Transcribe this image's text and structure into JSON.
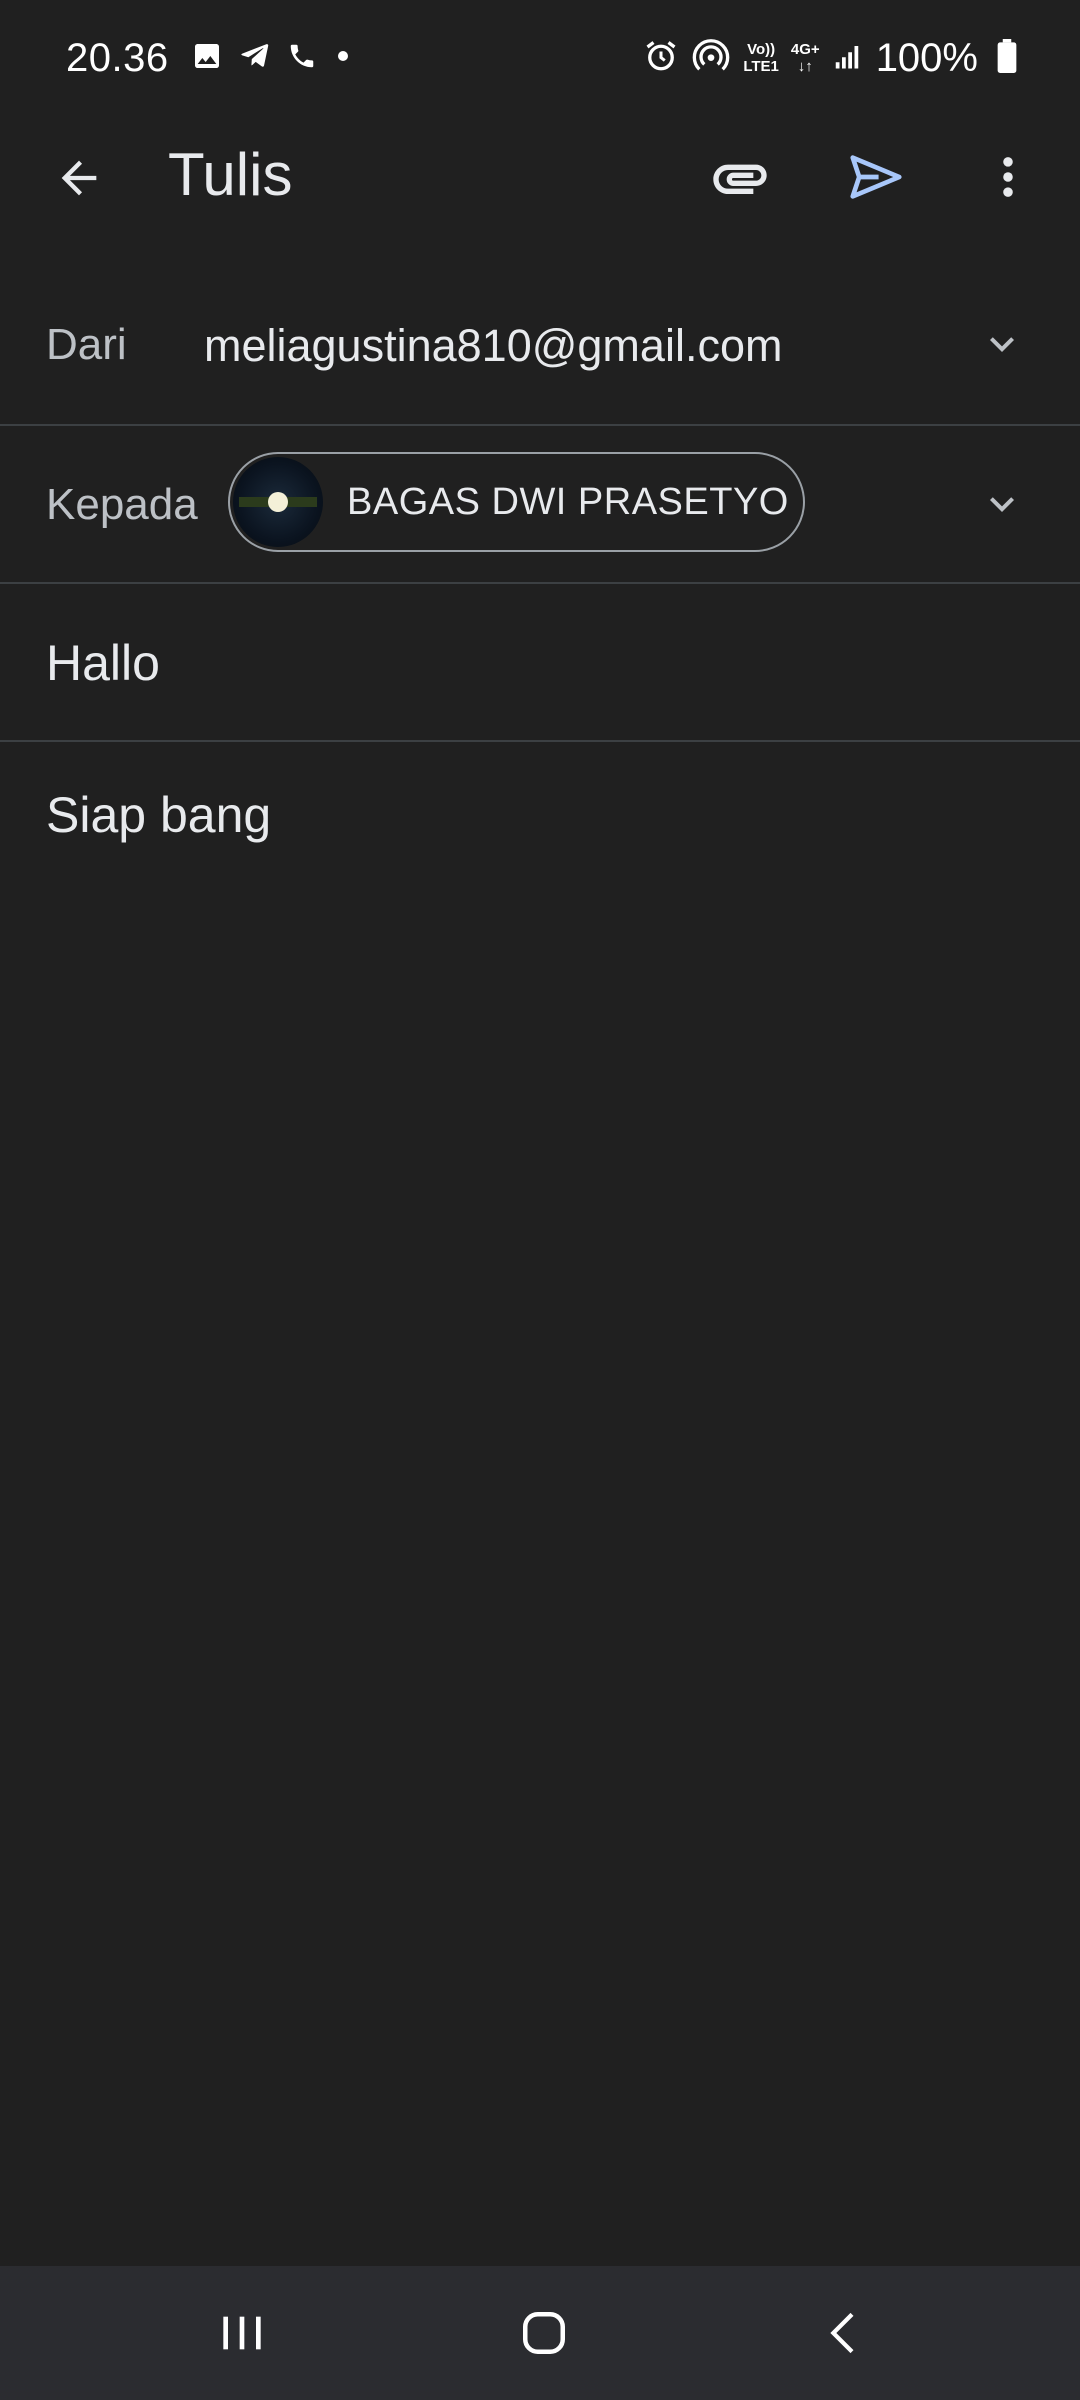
{
  "status_bar": {
    "time": "20.36",
    "signal_top": "Vo))",
    "signal_bottom": "LTE1",
    "network_type": "4G+",
    "battery": "100%"
  },
  "app_bar": {
    "title": "Tulis",
    "icons": [
      "back-arrow-icon",
      "attachment-icon",
      "send-icon",
      "more-vert-icon"
    ],
    "accent_color": "#a8c7fa"
  },
  "compose": {
    "from_label": "Dari",
    "from_value": "meliagustina810@gmail.com",
    "to_label": "Kepada",
    "recipient_name": "BAGAS DWI PRASETYO",
    "subject": "Hallo",
    "body": "Siap bang"
  },
  "nav_bar": {
    "icons": [
      "recents-icon",
      "home-icon",
      "back-icon"
    ]
  }
}
